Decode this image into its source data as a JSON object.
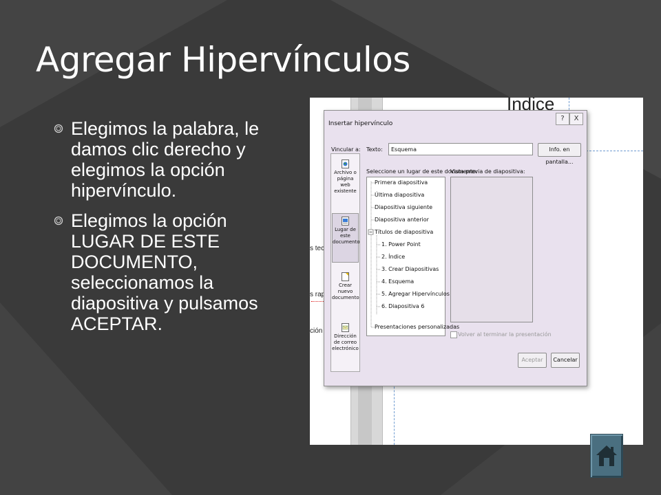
{
  "slide": {
    "title": "Agregar Hipervínculos",
    "bullets": [
      "Elegimos la palabra, le damos clic derecho y elegimos la opción hipervínculo.",
      "Elegimos la opción LUGAR DE ESTE DOCUMENTO, seleccionamos la diapositiva y pulsamos ACEPTAR."
    ],
    "home_icon": "home-icon"
  },
  "screenshot": {
    "background_heading": "Indice",
    "side_texts": [
      "s tecla",
      "s rapid",
      "ción"
    ],
    "dialog": {
      "title": "Insertar hipervínculo",
      "help_button": "?",
      "close_button": "X",
      "link_to_label": "Vincular a:",
      "text_label": "Texto:",
      "text_value": "Esquema",
      "screentip_button": "Info. en pantalla...",
      "place_label": "Seleccione un lugar de este documento:",
      "preview_label": "Vista previa de diapositiva:",
      "nav_items": [
        "Archivo o página web existente",
        "Lugar de este documento",
        "Crear nuevo documento",
        "Dirección de correo electrónico"
      ],
      "tree_items": [
        "Primera diapositiva",
        "Última diapositiva",
        "Diapositiva siguiente",
        "Diapositiva anterior",
        "Títulos de diapositiva",
        "1. Power Point",
        "2. Índice",
        "3. Crear Diapositivas",
        "4. Esquema",
        "5. Agregar Hipervínculos",
        "6. Diapositiva 6",
        "Presentaciones personalizadas"
      ],
      "return_checkbox_label": "Volver al terminar la presentación",
      "ok_button": "Aceptar",
      "cancel_button": "Cancelar"
    }
  },
  "colors": {
    "background": "#3a3a3a",
    "dialog_bg": "#e9e1ee",
    "home_button": "#4a6f80"
  }
}
